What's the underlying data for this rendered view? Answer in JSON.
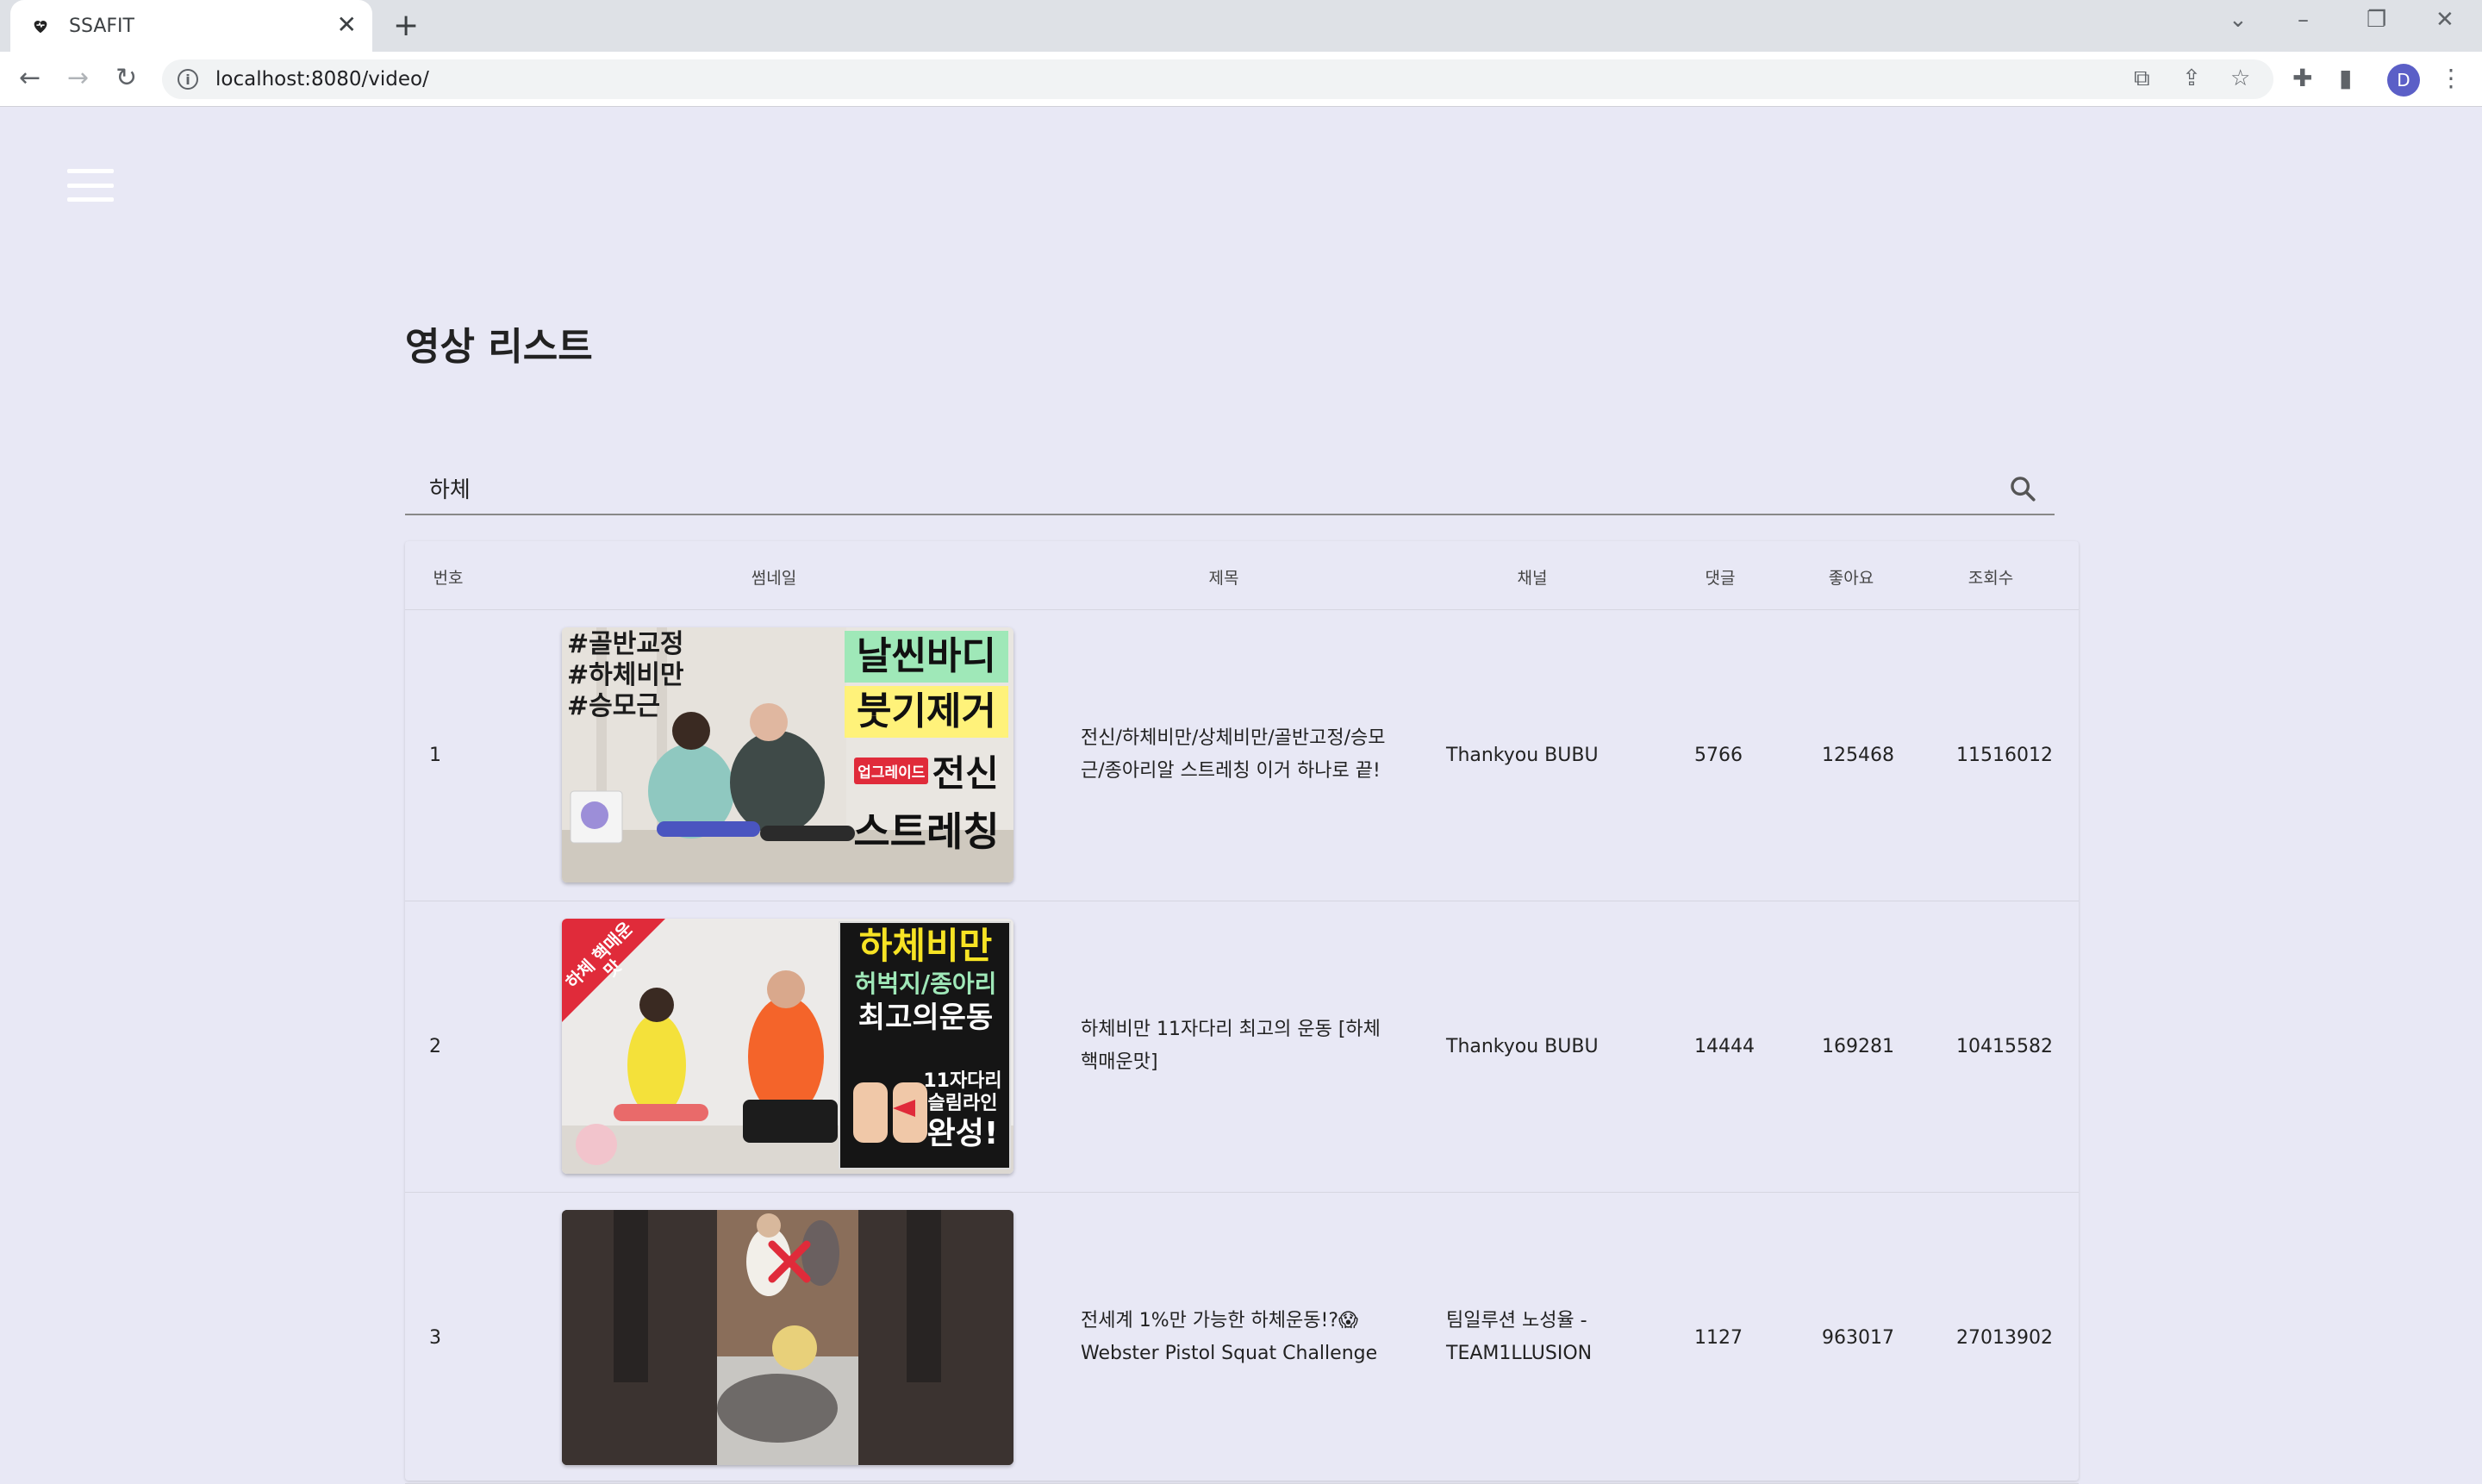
{
  "browser": {
    "tab_title": "SSAFIT",
    "url": "localhost:8080/video/",
    "profile_initial": "D"
  },
  "page": {
    "title": "영상 리스트",
    "search_value": "하체"
  },
  "table": {
    "headers": {
      "num": "번호",
      "thumb": "썸네일",
      "title": "제목",
      "channel": "채널",
      "comments": "댓글",
      "likes": "좋아요",
      "views": "조회수"
    },
    "rows": [
      {
        "num": "1",
        "title": "전신/하체비만/상체비만/골반고정/승모근/종아리알 스트레칭 이거 하나로 끝!",
        "channel": "Thankyou BUBU",
        "comments": "5766",
        "likes": "125468",
        "views": "11516012",
        "thumb_text": [
          "#골반교정",
          "#하체비만",
          "#승모근",
          "날씬바디",
          "붓기제거",
          "업그레이드",
          "전신",
          "스트레칭"
        ]
      },
      {
        "num": "2",
        "title": "하체비만 11자다리 최고의 운동 [하체 핵매운맛]",
        "channel": "Thankyou BUBU",
        "comments": "14444",
        "likes": "169281",
        "views": "10415582",
        "thumb_text": [
          "하체 핵매운맛",
          "하체비만",
          "허벅지/종아리",
          "최고의운동",
          "11자다리",
          "슬림라인",
          "완성!"
        ]
      },
      {
        "num": "3",
        "title": "전세계 1%만 가능한 하체운동!?😱 Webster Pistol Squat Challenge",
        "channel": "팀일루션 노성율 - TEAM1LLUSION",
        "comments": "1127",
        "likes": "963017",
        "views": "27013902"
      }
    ]
  },
  "colors": {
    "page_bg": "#e8e8f5",
    "chrome_bg": "#dee1e6",
    "thumb1_green": "#9fe8b8",
    "thumb1_yellow": "#fff27a",
    "thumb2_yellow": "#f7e324",
    "thumb_red": "#e02b3a"
  }
}
